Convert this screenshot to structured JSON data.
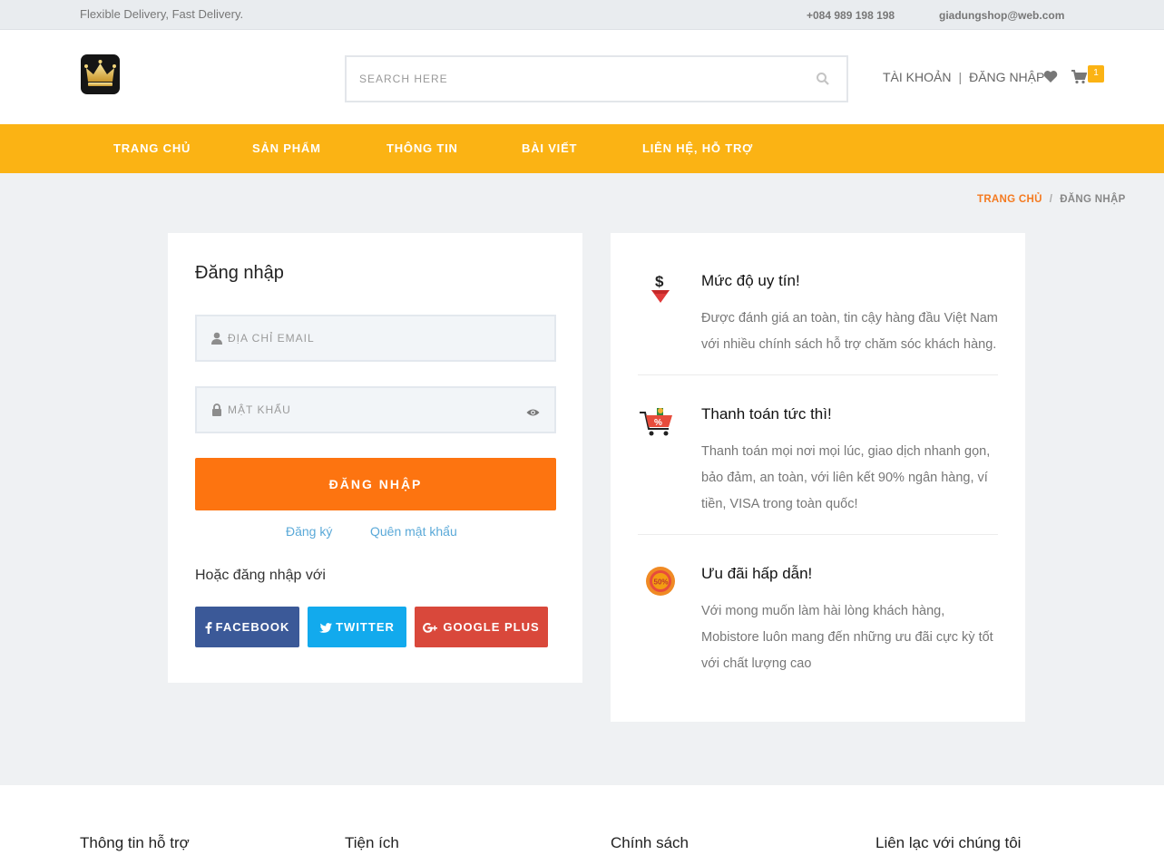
{
  "topbar": {
    "tagline": "Flexible Delivery, Fast Delivery.",
    "phone": "+084 989 198 198",
    "email": "giadungshop@web.com"
  },
  "header": {
    "logo_icon": "crown-icon",
    "search_placeholder": "SEARCH HERE",
    "account_label": "TÀI KHOẢN",
    "separator": "|",
    "login_label": "ĐĂNG NHẬP",
    "cart_count": "1"
  },
  "nav": {
    "items": [
      "TRANG CHỦ",
      "SẢN PHẨM",
      "THÔNG TIN",
      "BÀI VIẾT",
      "LIÊN HỆ, HỖ TRỢ"
    ]
  },
  "breadcrumb": {
    "home": "TRANG CHỦ",
    "separator": "/",
    "current": "ĐĂNG NHẬP"
  },
  "login": {
    "title": "Đăng nhập",
    "email_placeholder": "ĐỊA CHỈ EMAIL",
    "password_placeholder": "MẬT KHẨU",
    "submit_label": "ĐĂNG NHẬP",
    "register_link": "Đăng ký",
    "forgot_link": "Quên mật khẩu",
    "social_heading": "Hoặc đăng nhập với",
    "facebook_label": "FACEBOOK",
    "twitter_label": "TWITTER",
    "google_label": "GOOGLE PLUS"
  },
  "features": [
    {
      "icon": "dollar-diamond-icon",
      "title": "Mức độ uy tín!",
      "text": "Được đánh giá an toàn, tin cậy hàng đầu Việt Nam với nhiều chính sách hỗ trợ chăm sóc khách hàng."
    },
    {
      "icon": "shopping-cart-percent-icon",
      "title": "Thanh toán tức thì!",
      "text": "Thanh toán mọi nơi mọi lúc, giao dịch nhanh gọn, bảo đảm, an toàn, với liên kết 90% ngân hàng, ví tiền, VISA trong toàn quốc!"
    },
    {
      "icon": "discount-50-badge-icon",
      "title": "Ưu đãi hấp dẫn!",
      "text": "Với mong muốn làm hài lòng khách hàng, Mobistore luôn mang đến những ưu đãi cực kỳ tốt với chất lượng cao"
    }
  ],
  "footer": {
    "columns": [
      "Thông tin hỗ trợ",
      "Tiện ích",
      "Chính sách",
      "Liên lạc với chúng tôi"
    ]
  },
  "colors": {
    "accent_yellow": "#fbb314",
    "primary_orange": "#fd7410",
    "breadcrumb_orange": "#f47a20",
    "link_blue": "#5aa9d8",
    "facebook": "#3b5998",
    "twitter": "#12aaed",
    "google": "#d9483b"
  }
}
